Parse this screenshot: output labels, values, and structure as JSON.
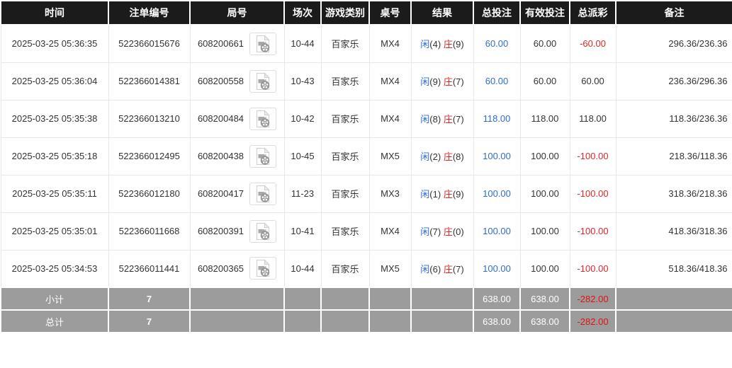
{
  "colors": {
    "header_bg": "#1b1b1b",
    "header_text": "#ffffff",
    "row_text": "#333333",
    "accent_blue": "#2d6cd2",
    "accent_red": "#e02626",
    "footer_bg": "#9c9c9c",
    "footer_text": "#ffffff",
    "cell_border": "#e8e8e8"
  },
  "table": {
    "headers": [
      "时间",
      "注单编号",
      "局号",
      "场次",
      "游戏类别",
      "桌号",
      "结果",
      "总投注",
      "有效投注",
      "总派彩",
      "备注"
    ],
    "video_icon": "video-file-icon",
    "rows": [
      {
        "time": "2025-03-25 05:36:35",
        "bet_id": "522366015676",
        "round_id": "608200661",
        "session": "10-44",
        "game_type": "百家乐",
        "table_no": "MX4",
        "result": {
          "player_label": "闲",
          "player_score": "(4)",
          "banker_label": "庄",
          "banker_score": "(9)"
        },
        "total_bet": "60.00",
        "valid_bet": "60.00",
        "payout": "-60.00",
        "remark": "296.36/236.36"
      },
      {
        "time": "2025-03-25 05:36:04",
        "bet_id": "522366014381",
        "round_id": "608200558",
        "session": "10-43",
        "game_type": "百家乐",
        "table_no": "MX4",
        "result": {
          "player_label": "闲",
          "player_score": "(9)",
          "banker_label": "庄",
          "banker_score": "(7)"
        },
        "total_bet": "60.00",
        "valid_bet": "60.00",
        "payout": "60.00",
        "remark": "236.36/296.36"
      },
      {
        "time": "2025-03-25 05:35:38",
        "bet_id": "522366013210",
        "round_id": "608200484",
        "session": "10-42",
        "game_type": "百家乐",
        "table_no": "MX4",
        "result": {
          "player_label": "闲",
          "player_score": "(8)",
          "banker_label": "庄",
          "banker_score": "(7)"
        },
        "total_bet": "118.00",
        "valid_bet": "118.00",
        "payout": "118.00",
        "remark": "118.36/236.36"
      },
      {
        "time": "2025-03-25 05:35:18",
        "bet_id": "522366012495",
        "round_id": "608200438",
        "session": "10-45",
        "game_type": "百家乐",
        "table_no": "MX5",
        "result": {
          "player_label": "闲",
          "player_score": "(2)",
          "banker_label": "庄",
          "banker_score": "(8)"
        },
        "total_bet": "100.00",
        "valid_bet": "100.00",
        "payout": "-100.00",
        "remark": "218.36/118.36"
      },
      {
        "time": "2025-03-25 05:35:11",
        "bet_id": "522366012180",
        "round_id": "608200417",
        "session": "11-23",
        "game_type": "百家乐",
        "table_no": "MX3",
        "result": {
          "player_label": "闲",
          "player_score": "(1)",
          "banker_label": "庄",
          "banker_score": "(9)"
        },
        "total_bet": "100.00",
        "valid_bet": "100.00",
        "payout": "-100.00",
        "remark": "318.36/218.36"
      },
      {
        "time": "2025-03-25 05:35:01",
        "bet_id": "522366011668",
        "round_id": "608200391",
        "session": "10-41",
        "game_type": "百家乐",
        "table_no": "MX4",
        "result": {
          "player_label": "闲",
          "player_score": "(7)",
          "banker_label": "庄",
          "banker_score": "(0)"
        },
        "total_bet": "100.00",
        "valid_bet": "100.00",
        "payout": "-100.00",
        "remark": "418.36/318.36"
      },
      {
        "time": "2025-03-25 05:34:53",
        "bet_id": "522366011441",
        "round_id": "608200365",
        "session": "10-44",
        "game_type": "百家乐",
        "table_no": "MX5",
        "result": {
          "player_label": "闲",
          "player_score": "(6)",
          "banker_label": "庄",
          "banker_score": "(7)"
        },
        "total_bet": "100.00",
        "valid_bet": "100.00",
        "payout": "-100.00",
        "remark": "518.36/418.36"
      }
    ],
    "footer_rows": [
      {
        "label": "小计",
        "count": "7",
        "total_bet": "638.00",
        "valid_bet": "638.00",
        "payout": "-282.00",
        "remark": ""
      },
      {
        "label": "总计",
        "count": "7",
        "total_bet": "638.00",
        "valid_bet": "638.00",
        "payout": "-282.00",
        "remark": ""
      }
    ]
  }
}
